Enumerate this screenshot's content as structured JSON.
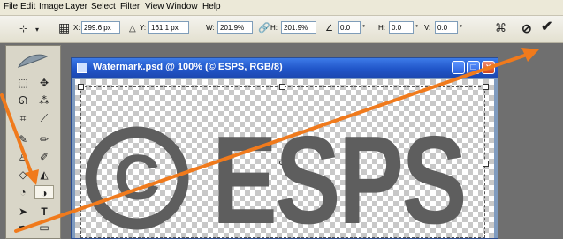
{
  "menu": [
    "File",
    "Edit",
    "Image",
    "Layer",
    "Select",
    "Filter",
    "View",
    "Window",
    "Help"
  ],
  "options": {
    "x_label": "X:",
    "x_value": "299.6 px",
    "y_label": "Y:",
    "y_value": "161.1 px",
    "w_label": "W:",
    "w_value": "201.9%",
    "h_label": "H:",
    "h_value": "201.9%",
    "angle_value": "0.0",
    "hskew_label": "H:",
    "hskew_value": "0.0",
    "vskew_label": "V:",
    "vskew_value": "0.0",
    "degree_symbol": "°"
  },
  "document": {
    "title": "Watermark.psd @ 100% (© ESPS, RGB/8)",
    "watermark_symbol": "©",
    "watermark_text": "ESPS"
  },
  "icons": [
    "move-tool-icon",
    "reference-point-icon",
    "delta-icon",
    "link-icon",
    "angle-icon",
    "warp-icon",
    "cancel-transform-icon",
    "commit-transform-icon"
  ],
  "colors": {
    "arrow": "#f07a1c",
    "xp_titlebar": "#2156c9",
    "watermark": "#5e5e5e"
  }
}
